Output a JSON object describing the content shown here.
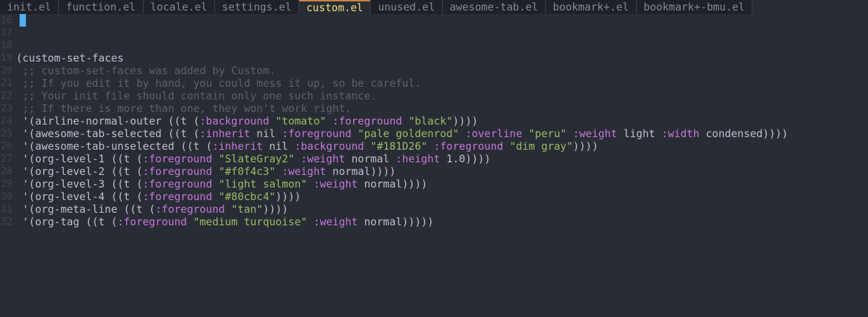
{
  "tabs": [
    {
      "label": "init.el",
      "active": false
    },
    {
      "label": "function.el",
      "active": false
    },
    {
      "label": "locale.el",
      "active": false
    },
    {
      "label": "settings.el",
      "active": false
    },
    {
      "label": "custom.el",
      "active": true
    },
    {
      "label": "unused.el",
      "active": false
    },
    {
      "label": "awesome-tab.el",
      "active": false
    },
    {
      "label": "bookmark+.el",
      "active": false
    },
    {
      "label": "bookmark+-bmu.el",
      "active": false
    }
  ],
  "colors": {
    "background": "#282c34",
    "comment": "#5b6268",
    "keyword": "#c678dd",
    "string": "#98be65",
    "text": "#bbc2cf",
    "cursor": "#51afef",
    "active_tab": "#eedd82"
  },
  "editor": {
    "lines": [
      {
        "num": "16",
        "tokens": [],
        "cursor": true
      },
      {
        "num": "17",
        "tokens": []
      },
      {
        "num": "18",
        "tokens": []
      },
      {
        "num": "19",
        "tokens": [
          {
            "t": "nm",
            "v": "(custom-set-faces"
          }
        ]
      },
      {
        "num": "20",
        "tokens": [
          {
            "t": "cm",
            "v": " ;; custom-set-faces was added by Custom."
          }
        ]
      },
      {
        "num": "21",
        "tokens": [
          {
            "t": "cm",
            "v": " ;; If you edit it by hand, you could mess it up, so be careful."
          }
        ]
      },
      {
        "num": "22",
        "tokens": [
          {
            "t": "cm",
            "v": " ;; Your init file should contain only one such instance."
          }
        ]
      },
      {
        "num": "23",
        "tokens": [
          {
            "t": "cm",
            "v": " ;; If there is more than one, they won't work right."
          }
        ]
      },
      {
        "num": "24",
        "tokens": [
          {
            "t": "nm",
            "v": " '(airline-normal-outer ((t ("
          },
          {
            "t": "kw",
            "v": ":background"
          },
          {
            "t": "nm",
            "v": " "
          },
          {
            "t": "st",
            "v": "\"tomato\""
          },
          {
            "t": "nm",
            "v": " "
          },
          {
            "t": "kw",
            "v": ":foreground"
          },
          {
            "t": "nm",
            "v": " "
          },
          {
            "t": "st",
            "v": "\"black\""
          },
          {
            "t": "nm",
            "v": "))))"
          }
        ]
      },
      {
        "num": "25",
        "tokens": [
          {
            "t": "nm",
            "v": " '(awesome-tab-selected ((t ("
          },
          {
            "t": "kw",
            "v": ":inherit"
          },
          {
            "t": "nm",
            "v": " nil "
          },
          {
            "t": "kw",
            "v": ":foreground"
          },
          {
            "t": "nm",
            "v": " "
          },
          {
            "t": "st",
            "v": "\"pale goldenrod\""
          },
          {
            "t": "nm",
            "v": " "
          },
          {
            "t": "kw",
            "v": ":overline"
          },
          {
            "t": "nm",
            "v": " "
          },
          {
            "t": "st",
            "v": "\"peru\""
          },
          {
            "t": "nm",
            "v": " "
          },
          {
            "t": "kw",
            "v": ":weight"
          },
          {
            "t": "nm",
            "v": " light "
          },
          {
            "t": "kw",
            "v": ":width"
          },
          {
            "t": "nm",
            "v": " condensed))))"
          }
        ]
      },
      {
        "num": "26",
        "tokens": [
          {
            "t": "nm",
            "v": " '(awesome-tab-unselected ((t ("
          },
          {
            "t": "kw",
            "v": ":inherit"
          },
          {
            "t": "nm",
            "v": " nil "
          },
          {
            "t": "kw",
            "v": ":background"
          },
          {
            "t": "nm",
            "v": " "
          },
          {
            "t": "st",
            "v": "\"#181D26\""
          },
          {
            "t": "nm",
            "v": " "
          },
          {
            "t": "kw",
            "v": ":foreground"
          },
          {
            "t": "nm",
            "v": " "
          },
          {
            "t": "st",
            "v": "\"dim gray\""
          },
          {
            "t": "nm",
            "v": "))))"
          }
        ]
      },
      {
        "num": "27",
        "tokens": [
          {
            "t": "nm",
            "v": " '(org-level-1 ((t ("
          },
          {
            "t": "kw",
            "v": ":foreground"
          },
          {
            "t": "nm",
            "v": " "
          },
          {
            "t": "st",
            "v": "\"SlateGray2\""
          },
          {
            "t": "nm",
            "v": " "
          },
          {
            "t": "kw",
            "v": ":weight"
          },
          {
            "t": "nm",
            "v": " normal "
          },
          {
            "t": "kw",
            "v": ":height"
          },
          {
            "t": "nm",
            "v": " 1.0))))"
          }
        ]
      },
      {
        "num": "28",
        "tokens": [
          {
            "t": "nm",
            "v": " '(org-level-2 ((t ("
          },
          {
            "t": "kw",
            "v": ":foreground"
          },
          {
            "t": "nm",
            "v": " "
          },
          {
            "t": "st",
            "v": "\"#f0f4c3\""
          },
          {
            "t": "nm",
            "v": " "
          },
          {
            "t": "kw",
            "v": ":weight"
          },
          {
            "t": "nm",
            "v": " normal))))"
          }
        ]
      },
      {
        "num": "29",
        "tokens": [
          {
            "t": "nm",
            "v": " '(org-level-3 ((t ("
          },
          {
            "t": "kw",
            "v": ":foreground"
          },
          {
            "t": "nm",
            "v": " "
          },
          {
            "t": "st",
            "v": "\"light salmon\""
          },
          {
            "t": "nm",
            "v": " "
          },
          {
            "t": "kw",
            "v": ":weight"
          },
          {
            "t": "nm",
            "v": " normal))))"
          }
        ]
      },
      {
        "num": "30",
        "tokens": [
          {
            "t": "nm",
            "v": " '(org-level-4 ((t ("
          },
          {
            "t": "kw",
            "v": ":foreground"
          },
          {
            "t": "nm",
            "v": " "
          },
          {
            "t": "st",
            "v": "\"#80cbc4\""
          },
          {
            "t": "nm",
            "v": "))))"
          }
        ]
      },
      {
        "num": "31",
        "tokens": [
          {
            "t": "nm",
            "v": " '(org-meta-line ((t ("
          },
          {
            "t": "kw",
            "v": ":foreground"
          },
          {
            "t": "nm",
            "v": " "
          },
          {
            "t": "st",
            "v": "\"tan\""
          },
          {
            "t": "nm",
            "v": "))))"
          }
        ]
      },
      {
        "num": "32",
        "tokens": [
          {
            "t": "nm",
            "v": " '(org-tag ((t ("
          },
          {
            "t": "kw",
            "v": ":foreground"
          },
          {
            "t": "nm",
            "v": " "
          },
          {
            "t": "st",
            "v": "\"medium turquoise\""
          },
          {
            "t": "nm",
            "v": " "
          },
          {
            "t": "kw",
            "v": ":weight"
          },
          {
            "t": "nm",
            "v": " normal)))))"
          }
        ]
      }
    ]
  }
}
